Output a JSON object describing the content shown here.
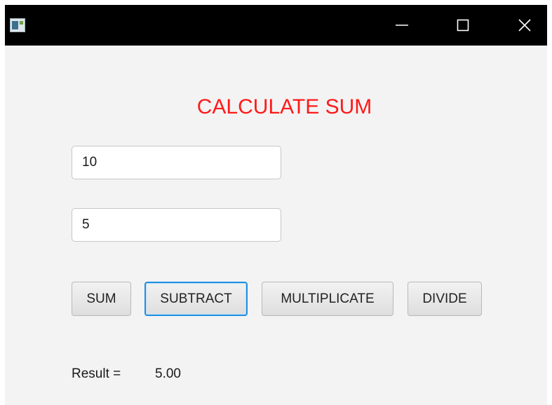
{
  "window": {
    "app_icon": "app-icon",
    "controls": {
      "minimize": "minimize-icon",
      "maximize": "maximize-icon",
      "close": "close-icon"
    }
  },
  "main": {
    "title": "CALCULATE SUM",
    "title_color": "#ff1a1a",
    "inputs": [
      {
        "value": "10"
      },
      {
        "value": "5"
      }
    ],
    "buttons": {
      "sum": "SUM",
      "subtract": "SUBTRACT",
      "multiplicate": "MULTIPLICATE",
      "divide": "DIVIDE"
    },
    "focused_button": "SUBTRACT",
    "focus_color": "#1f8fe0",
    "result_label": "Result =",
    "result_value": "5.00"
  }
}
